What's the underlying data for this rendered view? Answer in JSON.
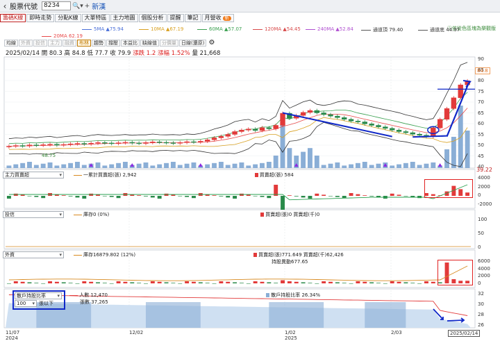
{
  "header": {
    "title": "股票代號",
    "code": "8234",
    "stock_name": "新漢"
  },
  "tabs": [
    {
      "label": "籌碼K線",
      "active": true
    },
    {
      "label": "即時走勢",
      "active": false
    },
    {
      "label": "分點K線",
      "active": false
    },
    {
      "label": "大單特區",
      "active": false
    },
    {
      "label": "主力地圖",
      "active": false
    },
    {
      "label": "個股分析",
      "active": false
    },
    {
      "label": "提醒",
      "active": false
    },
    {
      "label": "筆記",
      "active": false
    },
    {
      "label": "月營收",
      "active": false,
      "badge": "新"
    }
  ],
  "ma_legend": [
    {
      "label": "5MA ▲75.94",
      "color": "#4a6fd8"
    },
    {
      "label": "10MA ▲67.19",
      "color": "#d8a020"
    },
    {
      "label": "60MA ▲57.07",
      "color": "#3aa050"
    },
    {
      "label": "120MA ▲54.45",
      "color": "#d84a4a"
    },
    {
      "label": "240MA ▲52.84",
      "color": "#b050d0"
    },
    {
      "label": "通道頂 79.40",
      "color": "#555555"
    },
    {
      "label": "通道底 44.97",
      "color": "#555555"
    },
    {
      "label": "20MA 62.19",
      "color": "#e84a4a"
    }
  ],
  "hint": "ⓘ依從色區塊為樂觀版",
  "toolbar": [
    {
      "label": "均線",
      "state": "normal"
    },
    {
      "label": "外資",
      "state": "dim"
    },
    {
      "label": "投信",
      "state": "dim"
    },
    {
      "label": "主力",
      "state": "dim"
    },
    {
      "label": "融資",
      "state": "dim"
    },
    {
      "label": "布林",
      "state": "on"
    },
    {
      "label": "趨勢",
      "state": "normal"
    },
    {
      "label": "撐壓",
      "state": "normal"
    },
    {
      "label": "本益比",
      "state": "normal"
    },
    {
      "label": "缺線值",
      "state": "normal"
    },
    {
      "label": "分價量",
      "state": "dim"
    },
    {
      "label": "日線(還原)",
      "state": "normal"
    }
  ],
  "ohlc": {
    "date": "2025/02/14",
    "open": "開 80.3",
    "high": "高 84.8",
    "low": "低 77.7",
    "close": "收 79.9",
    "change": "漲跌 1.2",
    "change_pct": "漲幅 1.52%",
    "volume": "量 21,668"
  },
  "price_axis": {
    "ticks": [
      "90",
      "85",
      "80",
      "75",
      "70",
      "65",
      "60",
      "55",
      "50",
      "45",
      "40"
    ],
    "max_label": "84.8",
    "min_label": "48.75",
    "low_tag": "39.22"
  },
  "panel1": {
    "select": "主力買賣超",
    "legend1": "一累計買賣超(張) 2,942",
    "legend2": "買賣超(張) 584",
    "ticks": [
      "4000",
      "2000",
      "0",
      "-2000"
    ]
  },
  "panel2": {
    "select": "投信",
    "legend1": "庫存0 (0%)",
    "legend2": "買賣超(張)0 買賣超(千)0",
    "ticks": [
      "100",
      "50",
      "0"
    ]
  },
  "panel3": {
    "select": "外資",
    "legend1": "庫存16879.802 (12%)",
    "legend2": "買賣超(張)771.649 買賣超(千)62,426",
    "legend3": "持股異動677.65",
    "ticks": [
      "6000",
      "4000",
      "2000",
      "0"
    ]
  },
  "panel4": {
    "select": "散戶持股比率",
    "threshold": "100",
    "threshold_unit": "張以下",
    "legend1": "人數 12,470",
    "legend2": "張數 37,265",
    "legend3": "散戶持股比率 26.34%",
    "ticks": [
      "32",
      "30",
      "28",
      "26"
    ]
  },
  "x_axis": {
    "labels": [
      {
        "text": "11/07\n2024"
      },
      {
        "text": "12/02"
      },
      {
        "text": "1/02\n2025"
      },
      {
        "text": "2/03"
      }
    ],
    "current": "2025/02/14"
  },
  "colors": {
    "up": "#e23a3a",
    "down": "#2a8a4a",
    "volume": "#8aaed6",
    "accent_blue": "#1028c8"
  },
  "chart_data": {
    "type": "candlestick",
    "x_start": "2024-11-07",
    "x_end": "2025-02-14",
    "price_range": [
      40,
      90
    ],
    "close": [
      49.5,
      49.8,
      49.6,
      50.1,
      49.9,
      50.2,
      50.4,
      50.0,
      50.3,
      50.6,
      50.8,
      50.5,
      50.9,
      51.2,
      51.0,
      50.7,
      51.1,
      51.3,
      51.0,
      50.8,
      51.2,
      51.5,
      51.3,
      51.1,
      50.9,
      51.2,
      51.6,
      51.4,
      51.8,
      52.5,
      53.4,
      54.1,
      55.0,
      56.3,
      57.0,
      57.5,
      56.8,
      58.1,
      57.6,
      59.2,
      64.8,
      62.5,
      63.8,
      65.2,
      66.1,
      65.0,
      64.2,
      63.5,
      62.8,
      62.0,
      61.2,
      60.8,
      59.9,
      59.2,
      58.5,
      57.8,
      57.0,
      56.3,
      55.8,
      55.1,
      54.6,
      54.0,
      58.0,
      62.0,
      67.0,
      72.0,
      78.0,
      79.9
    ]
  }
}
